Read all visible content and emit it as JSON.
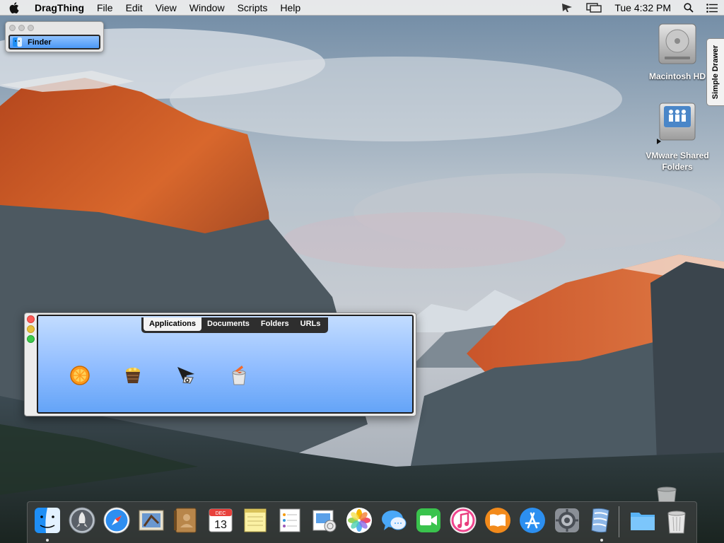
{
  "menubar": {
    "app_name": "DragThing",
    "menus": [
      "File",
      "Edit",
      "View",
      "Window",
      "Scripts",
      "Help"
    ],
    "clock": "Tue 4:32 PM",
    "status_icons": [
      "cursor-icon",
      "display-mirror-icon",
      "spotlight-icon",
      "notification-center-icon"
    ]
  },
  "mini_window": {
    "tab_label": "Finder"
  },
  "desktop": {
    "icons": [
      {
        "label": "Macintosh HD",
        "icon": "hard-drive-icon"
      },
      {
        "label": "VMware Shared Folders",
        "icon": "shared-folders-icon"
      }
    ],
    "drawer_label": "Simple Drawer"
  },
  "dragthing": {
    "tabs": [
      "Applications",
      "Documents",
      "Folders",
      "URLs"
    ],
    "active_tab": "Applications",
    "apps": [
      "orange-app-icon",
      "treasure-basket-icon",
      "cursor-app-icon",
      "paint-bucket-icon"
    ],
    "lights": [
      "#fc5b57",
      "#e5bf3c",
      "#3cc84a"
    ]
  },
  "dock": {
    "apps": [
      "finder-icon",
      "launchpad-icon",
      "safari-icon",
      "mail-icon",
      "contacts-icon",
      "calendar-icon",
      "notes-icon",
      "reminders-icon",
      "preview-icon",
      "photos-icon",
      "messages-icon",
      "facetime-icon",
      "itunes-icon",
      "ibooks-icon",
      "app-store-icon",
      "system-preferences-icon",
      "dragthing-icon"
    ],
    "calendar_month": "DEC",
    "calendar_day": "13",
    "right_items": [
      "downloads-folder-icon",
      "trash-icon"
    ]
  }
}
